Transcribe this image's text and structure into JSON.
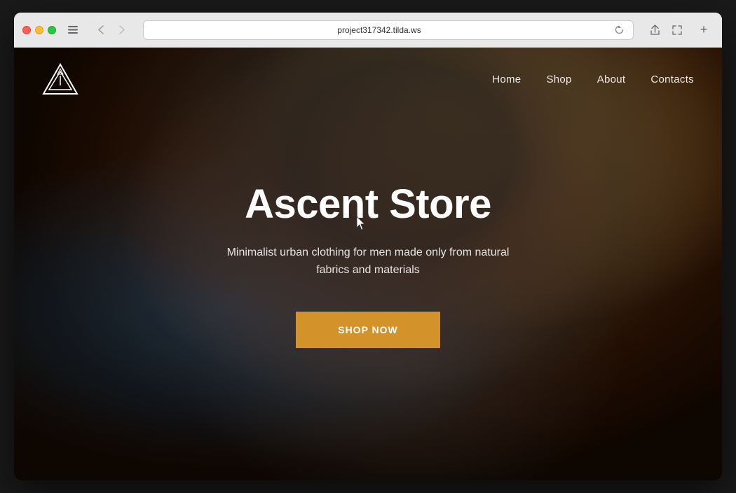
{
  "browser": {
    "url": "project317342.tilda.ws",
    "traffic_lights": {
      "red": "close",
      "yellow": "minimize",
      "green": "maximize"
    },
    "nav_back_label": "‹",
    "nav_forward_label": "›",
    "sidebar_label": "⊞",
    "refresh_label": "↻",
    "share_label": "⬆",
    "fullscreen_label": "⤢",
    "new_tab_label": "+"
  },
  "website": {
    "logo_alt": "Ascent Store Logo",
    "nav": {
      "links": [
        {
          "label": "Home",
          "href": "#"
        },
        {
          "label": "Shop",
          "href": "#"
        },
        {
          "label": "About",
          "href": "#"
        },
        {
          "label": "Contacts",
          "href": "#"
        }
      ]
    },
    "hero": {
      "title": "Ascent Store",
      "subtitle": "Minimalist urban clothing for men made only from natural fabrics and materials",
      "cta_label": "Shop now"
    },
    "colors": {
      "cta_bg": "#d4922a",
      "overlay": "rgba(0,0,0,0.45)"
    }
  }
}
